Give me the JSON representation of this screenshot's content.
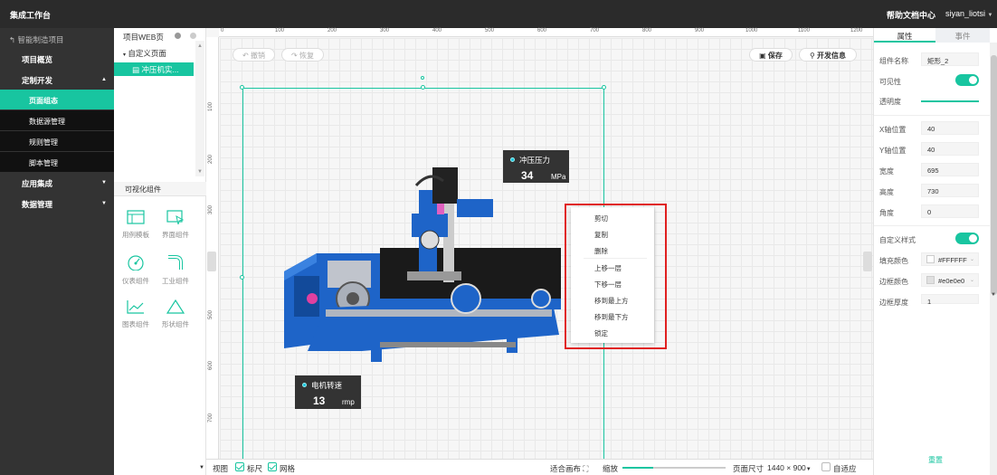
{
  "topbar": {
    "title": "集成工作台",
    "help": "帮助文档中心",
    "user": "siyan_liotsi"
  },
  "sidebar": {
    "project": "智能制造项目",
    "items": [
      {
        "label": "项目概览"
      },
      {
        "label": "定制开发"
      },
      {
        "label": "应用集成"
      },
      {
        "label": "数据管理"
      }
    ],
    "subitems": [
      {
        "label": "页面组态"
      },
      {
        "label": "数据源管理"
      },
      {
        "label": "规则管理"
      },
      {
        "label": "脚本管理"
      }
    ]
  },
  "tree": {
    "header": "项目WEB页",
    "node": "自定义页面",
    "selected": "冲压机实..."
  },
  "components": {
    "header": "可视化组件",
    "items": [
      {
        "label": "用例模板",
        "icon": "template-icon"
      },
      {
        "label": "界面组件",
        "icon": "cursor-icon"
      },
      {
        "label": "仪表组件",
        "icon": "gauge-icon"
      },
      {
        "label": "工业组件",
        "icon": "pipe-icon"
      },
      {
        "label": "图表组件",
        "icon": "line-chart-icon"
      },
      {
        "label": "形状组件",
        "icon": "triangle-icon"
      }
    ]
  },
  "toolbar": {
    "undo": "撤销",
    "redo": "恢复",
    "save": "保存",
    "devinfo": "开发信息"
  },
  "ruler": {
    "top": [
      "0",
      "100",
      "200",
      "300",
      "400",
      "500",
      "600",
      "700",
      "800",
      "900",
      "1000",
      "1100",
      "1200"
    ],
    "left": [
      "100",
      "200",
      "300",
      "400",
      "500",
      "600",
      "700"
    ]
  },
  "sensors": [
    {
      "name": "冲压压力",
      "value": "34",
      "unit": "MPa"
    },
    {
      "name": "电机转速",
      "value": "13",
      "unit": "rmp"
    }
  ],
  "contextmenu": [
    "剪切",
    "复制",
    "删除",
    "上移一层",
    "下移一层",
    "移到最上方",
    "移到最下方",
    "锁定"
  ],
  "bottombar": {
    "view": "视图",
    "ruler": "标尺",
    "grid": "网格",
    "fit": "适合画布",
    "zoom": "缩放",
    "zoom_level": 0.3,
    "pagesize_label": "页面尺寸",
    "pagesize": "1440 × 900",
    "autofit": "自适应"
  },
  "props": {
    "tab_attr": "属性",
    "tab_event": "事件",
    "name_label": "组件名称",
    "name": "矩形_2",
    "visible": "可见性",
    "opacity": "透明度",
    "opacity_value": 1,
    "x_label": "X轴位置",
    "x": "40",
    "y_label": "Y轴位置",
    "y": "40",
    "w_label": "宽度",
    "w": "695",
    "h_label": "高度",
    "h": "730",
    "angle_label": "角度",
    "angle": "0",
    "custom_style": "自定义样式",
    "fill_label": "填充颜色",
    "fill": "#FFFFFF",
    "border_label": "边框颜色",
    "border": "#e0e0e0",
    "border_w_label": "边框厚度",
    "border_w": "1",
    "reset": "重置"
  },
  "colors": {
    "accent": "#18c5a0",
    "sidebar": "#333333",
    "topbar": "#2b2b2b",
    "highlight": "#e02020"
  }
}
